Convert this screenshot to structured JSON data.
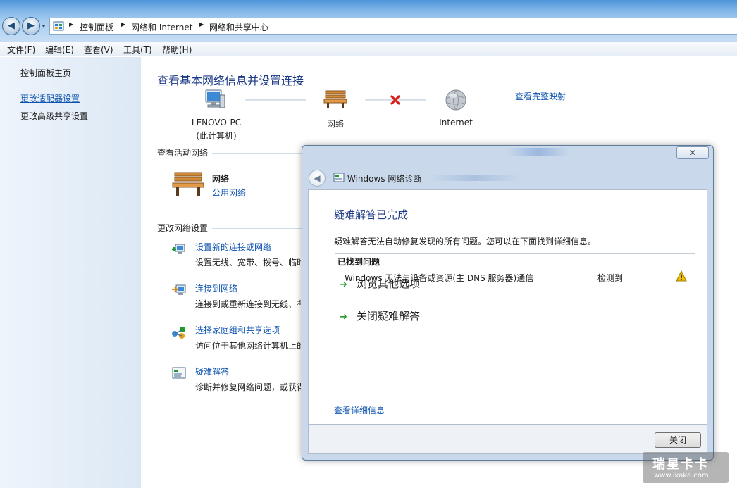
{
  "window": {
    "nav": {
      "back_glyph": "◀",
      "forward_glyph": "▶",
      "dropdown_glyph": "▾"
    },
    "address": {
      "crumbs": [
        "控制面板",
        "网络和 Internet",
        "网络和共享中心"
      ],
      "separator": "▶"
    },
    "menu": [
      "文件(F)",
      "编辑(E)",
      "查看(V)",
      "工具(T)",
      "帮助(H)"
    ]
  },
  "sidebar": {
    "items": [
      {
        "label": "控制面板主页"
      },
      {
        "label": "更改适配器设置"
      },
      {
        "label": "更改高级共享设置"
      }
    ]
  },
  "main": {
    "title": "查看基本网络信息并设置连接",
    "map": {
      "computer_name": "LENOVO-PC",
      "computer_note": "(此计算机)",
      "network_label": "网络",
      "internet_label": "Internet",
      "full_map_link": "查看完整映射"
    },
    "active_section": "查看活动网络",
    "active_network": {
      "name": "网络",
      "type": "公用网络"
    },
    "change_section": "更改网络设置",
    "tasks": [
      {
        "title": "设置新的连接或网络",
        "desc": "设置无线、宽带、拨号、临时"
      },
      {
        "title": "连接到网络",
        "desc": "连接到或重新连接到无线、有"
      },
      {
        "title": "选择家庭组和共享选项",
        "desc": "访问位于其他网络计算机上的"
      },
      {
        "title": "疑难解答",
        "desc": "诊断并修复网络问题，或获得"
      }
    ]
  },
  "dialog": {
    "close_glyph": "✕",
    "back_glyph": "◀",
    "app_title": "Windows 网络诊断",
    "heading": "疑难解答已完成",
    "description": "疑难解答无法自动修复发现的所有问题。您可以在下面找到详细信息。",
    "problems_header": "已找到问题",
    "problem": {
      "text": "Windows 无法与设备或资源(主 DNS 服务器)通信",
      "status": "检测到"
    },
    "commands": [
      {
        "label": "浏览其他选项"
      },
      {
        "label": "关闭疑难解答"
      }
    ],
    "command_arrow": "➜",
    "details_link": "查看详细信息",
    "close_button": "关闭"
  },
  "watermark": {
    "line1": "瑞星卡卡",
    "line2": "www.ikaka.com"
  },
  "colors": {
    "link": "#0d53b0",
    "title": "#1e3b87",
    "warning": "#f2c200",
    "error": "#d91e18"
  }
}
